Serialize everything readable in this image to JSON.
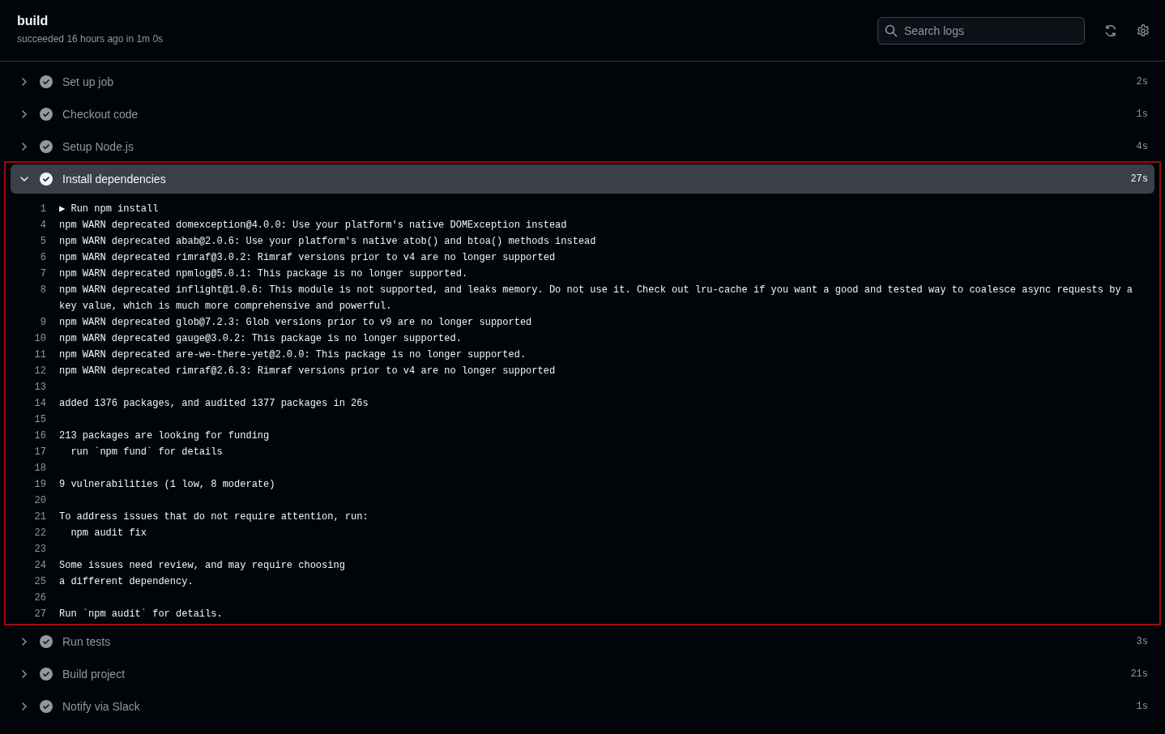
{
  "job": {
    "title": "build",
    "subtitle": "succeeded 16 hours ago in 1m 0s"
  },
  "search": {
    "placeholder": "Search logs"
  },
  "steps": [
    {
      "name": "Set up job",
      "duration": "2s",
      "expanded": false,
      "highlighted": false
    },
    {
      "name": "Checkout code",
      "duration": "1s",
      "expanded": false,
      "highlighted": false
    },
    {
      "name": "Setup Node.js",
      "duration": "4s",
      "expanded": false,
      "highlighted": false
    },
    {
      "name": "Install dependencies",
      "duration": "27s",
      "expanded": true,
      "highlighted": true,
      "log": [
        {
          "number": "1",
          "text": "▶ Run npm install"
        },
        {
          "number": "4",
          "text": "npm WARN deprecated domexception@4.0.0: Use your platform's native DOMException instead"
        },
        {
          "number": "5",
          "text": "npm WARN deprecated abab@2.0.6: Use your platform's native atob() and btoa() methods instead"
        },
        {
          "number": "6",
          "text": "npm WARN deprecated rimraf@3.0.2: Rimraf versions prior to v4 are no longer supported"
        },
        {
          "number": "7",
          "text": "npm WARN deprecated npmlog@5.0.1: This package is no longer supported."
        },
        {
          "number": "8",
          "text": "npm WARN deprecated inflight@1.0.6: This module is not supported, and leaks memory. Do not use it. Check out lru-cache if you want a good and tested way to coalesce async requests by a key value, which is much more comprehensive and powerful."
        },
        {
          "number": "9",
          "text": "npm WARN deprecated glob@7.2.3: Glob versions prior to v9 are no longer supported"
        },
        {
          "number": "10",
          "text": "npm WARN deprecated gauge@3.0.2: This package is no longer supported."
        },
        {
          "number": "11",
          "text": "npm WARN deprecated are-we-there-yet@2.0.0: This package is no longer supported."
        },
        {
          "number": "12",
          "text": "npm WARN deprecated rimraf@2.6.3: Rimraf versions prior to v4 are no longer supported"
        },
        {
          "number": "13"
        },
        {
          "number": "14",
          "text": "added 1376 packages, and audited 1377 packages in 26s"
        },
        {
          "number": "15"
        },
        {
          "number": "16",
          "text": "213 packages are looking for funding"
        },
        {
          "number": "17",
          "text": "  run `npm fund` for details"
        },
        {
          "number": "18"
        },
        {
          "number": "19",
          "text": "9 vulnerabilities (1 low, 8 moderate)"
        },
        {
          "number": "20"
        },
        {
          "number": "21",
          "text": "To address issues that do not require attention, run:"
        },
        {
          "number": "22",
          "text": "  npm audit fix"
        },
        {
          "number": "23"
        },
        {
          "number": "24",
          "text": "Some issues need review, and may require choosing"
        },
        {
          "number": "25",
          "text": "a different dependency."
        },
        {
          "number": "26"
        },
        {
          "number": "27",
          "text": "Run `npm audit` for details."
        }
      ]
    },
    {
      "name": "Run tests",
      "duration": "3s",
      "expanded": false,
      "highlighted": false
    },
    {
      "name": "Build project",
      "duration": "21s",
      "expanded": false,
      "highlighted": false
    },
    {
      "name": "Notify via Slack",
      "duration": "1s",
      "expanded": false,
      "highlighted": false
    }
  ]
}
